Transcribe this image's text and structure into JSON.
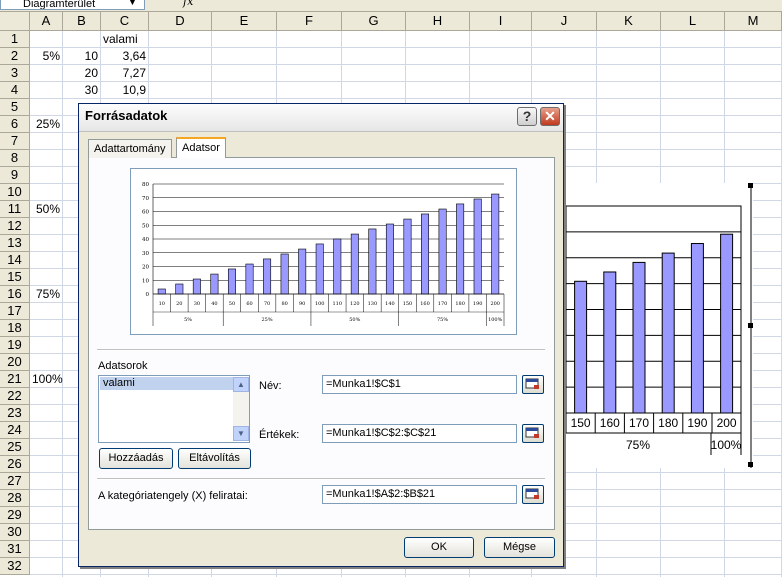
{
  "formula_bar": {
    "name_box": "Diagramterület",
    "fx": "fx"
  },
  "columns": [
    "A",
    "B",
    "C",
    "D",
    "E",
    "F",
    "G",
    "H",
    "I",
    "J",
    "K",
    "L",
    "M"
  ],
  "rows": [
    "1",
    "2",
    "3",
    "4",
    "5",
    "6",
    "7",
    "8",
    "9",
    "10",
    "11",
    "12",
    "13",
    "14",
    "15",
    "16",
    "17",
    "18",
    "19",
    "20",
    "21",
    "22",
    "23",
    "24",
    "25",
    "26",
    "27",
    "28",
    "29",
    "30",
    "31",
    "32"
  ],
  "cells": {
    "C1": "valami",
    "A2": "5%",
    "B2": "10",
    "C2": "3,64",
    "B3": "20",
    "C3": "7,27",
    "B4": "30",
    "C4": "10,9",
    "A6": "25%",
    "A11": "50%",
    "A16": "75%",
    "A21": "100%"
  },
  "sheet_chart": {
    "categories": [
      "150",
      "160",
      "170",
      "180",
      "190",
      "200"
    ],
    "values": [
      50.9,
      54.5,
      58.2,
      61.8,
      65.5,
      69.1
    ],
    "group_labels": [
      "75%",
      "100%"
    ]
  },
  "dialog": {
    "title": "Forrásadatok",
    "help_label": "?",
    "close_label": "✕",
    "tabs": [
      "Adattartomány",
      "Adatsor"
    ],
    "series_section_label": "Adatsorok",
    "series_items": [
      "valami"
    ],
    "name_label": "Név:",
    "name_value": "=Munka1!$C$1",
    "values_label": "Értékek:",
    "values_value": "=Munka1!$C$2:$C$21",
    "add_button": "Hozzáadás",
    "remove_button": "Eltávolítás",
    "category_label": "A kategóriatengely (X) feliratai:",
    "category_value": "=Munka1!$A$2:$B$21",
    "ok_button": "OK",
    "cancel_button": "Mégse"
  },
  "chart_data": {
    "type": "bar",
    "categories": [
      "10",
      "20",
      "30",
      "40",
      "50",
      "60",
      "70",
      "80",
      "90",
      "100",
      "110",
      "120",
      "130",
      "140",
      "150",
      "160",
      "170",
      "180",
      "190",
      "200"
    ],
    "group_labels": [
      "5%",
      "25%",
      "50%",
      "75%",
      "100%"
    ],
    "series": [
      {
        "name": "valami",
        "values": [
          3.64,
          7.27,
          10.9,
          14.5,
          18.2,
          21.8,
          25.5,
          29.1,
          32.7,
          36.4,
          40,
          43.6,
          47.3,
          50.9,
          54.5,
          58.2,
          61.8,
          65.5,
          69.1,
          72.7
        ]
      }
    ],
    "ylim": [
      0,
      80
    ],
    "yticks": [
      "0",
      "10",
      "20",
      "30",
      "40",
      "50",
      "60",
      "70",
      "80"
    ],
    "grid": true,
    "bar_color": "#9999ff"
  }
}
